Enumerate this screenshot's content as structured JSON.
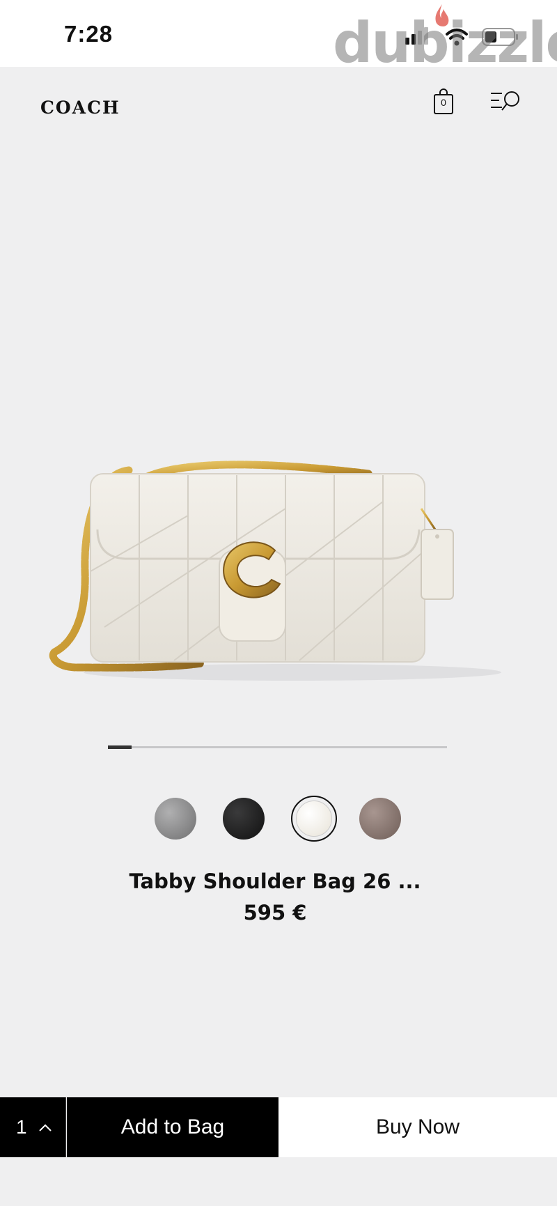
{
  "status_bar": {
    "time": "7:28",
    "icons": [
      "signal-icon",
      "wifi-icon",
      "battery-icon"
    ]
  },
  "watermark": {
    "text": "dubizzle"
  },
  "header": {
    "brand": "COACH",
    "bag_count": "0",
    "icons": [
      "shopping-bag-icon",
      "menu-search-icon"
    ]
  },
  "carousel": {
    "current": 1,
    "progress": 0.07
  },
  "swatches": [
    {
      "name": "Grey",
      "color": "#8e8e8f",
      "selected": false
    },
    {
      "name": "Black",
      "color": "#1d1d1e",
      "selected": false
    },
    {
      "name": "Chalk",
      "color": "#f1ede4",
      "selected": true
    },
    {
      "name": "Taupe",
      "color": "#8d7b74",
      "selected": false
    }
  ],
  "product": {
    "title": "Tabby Shoulder Bag 26 ...",
    "price": "595 €"
  },
  "bottom_bar": {
    "quantity": "1",
    "add_to_bag_label": "Add to Bag",
    "buy_now_label": "Buy Now"
  },
  "colors": {
    "background": "#efeff0",
    "primary_button": "#000000",
    "secondary_button": "#ffffff"
  }
}
